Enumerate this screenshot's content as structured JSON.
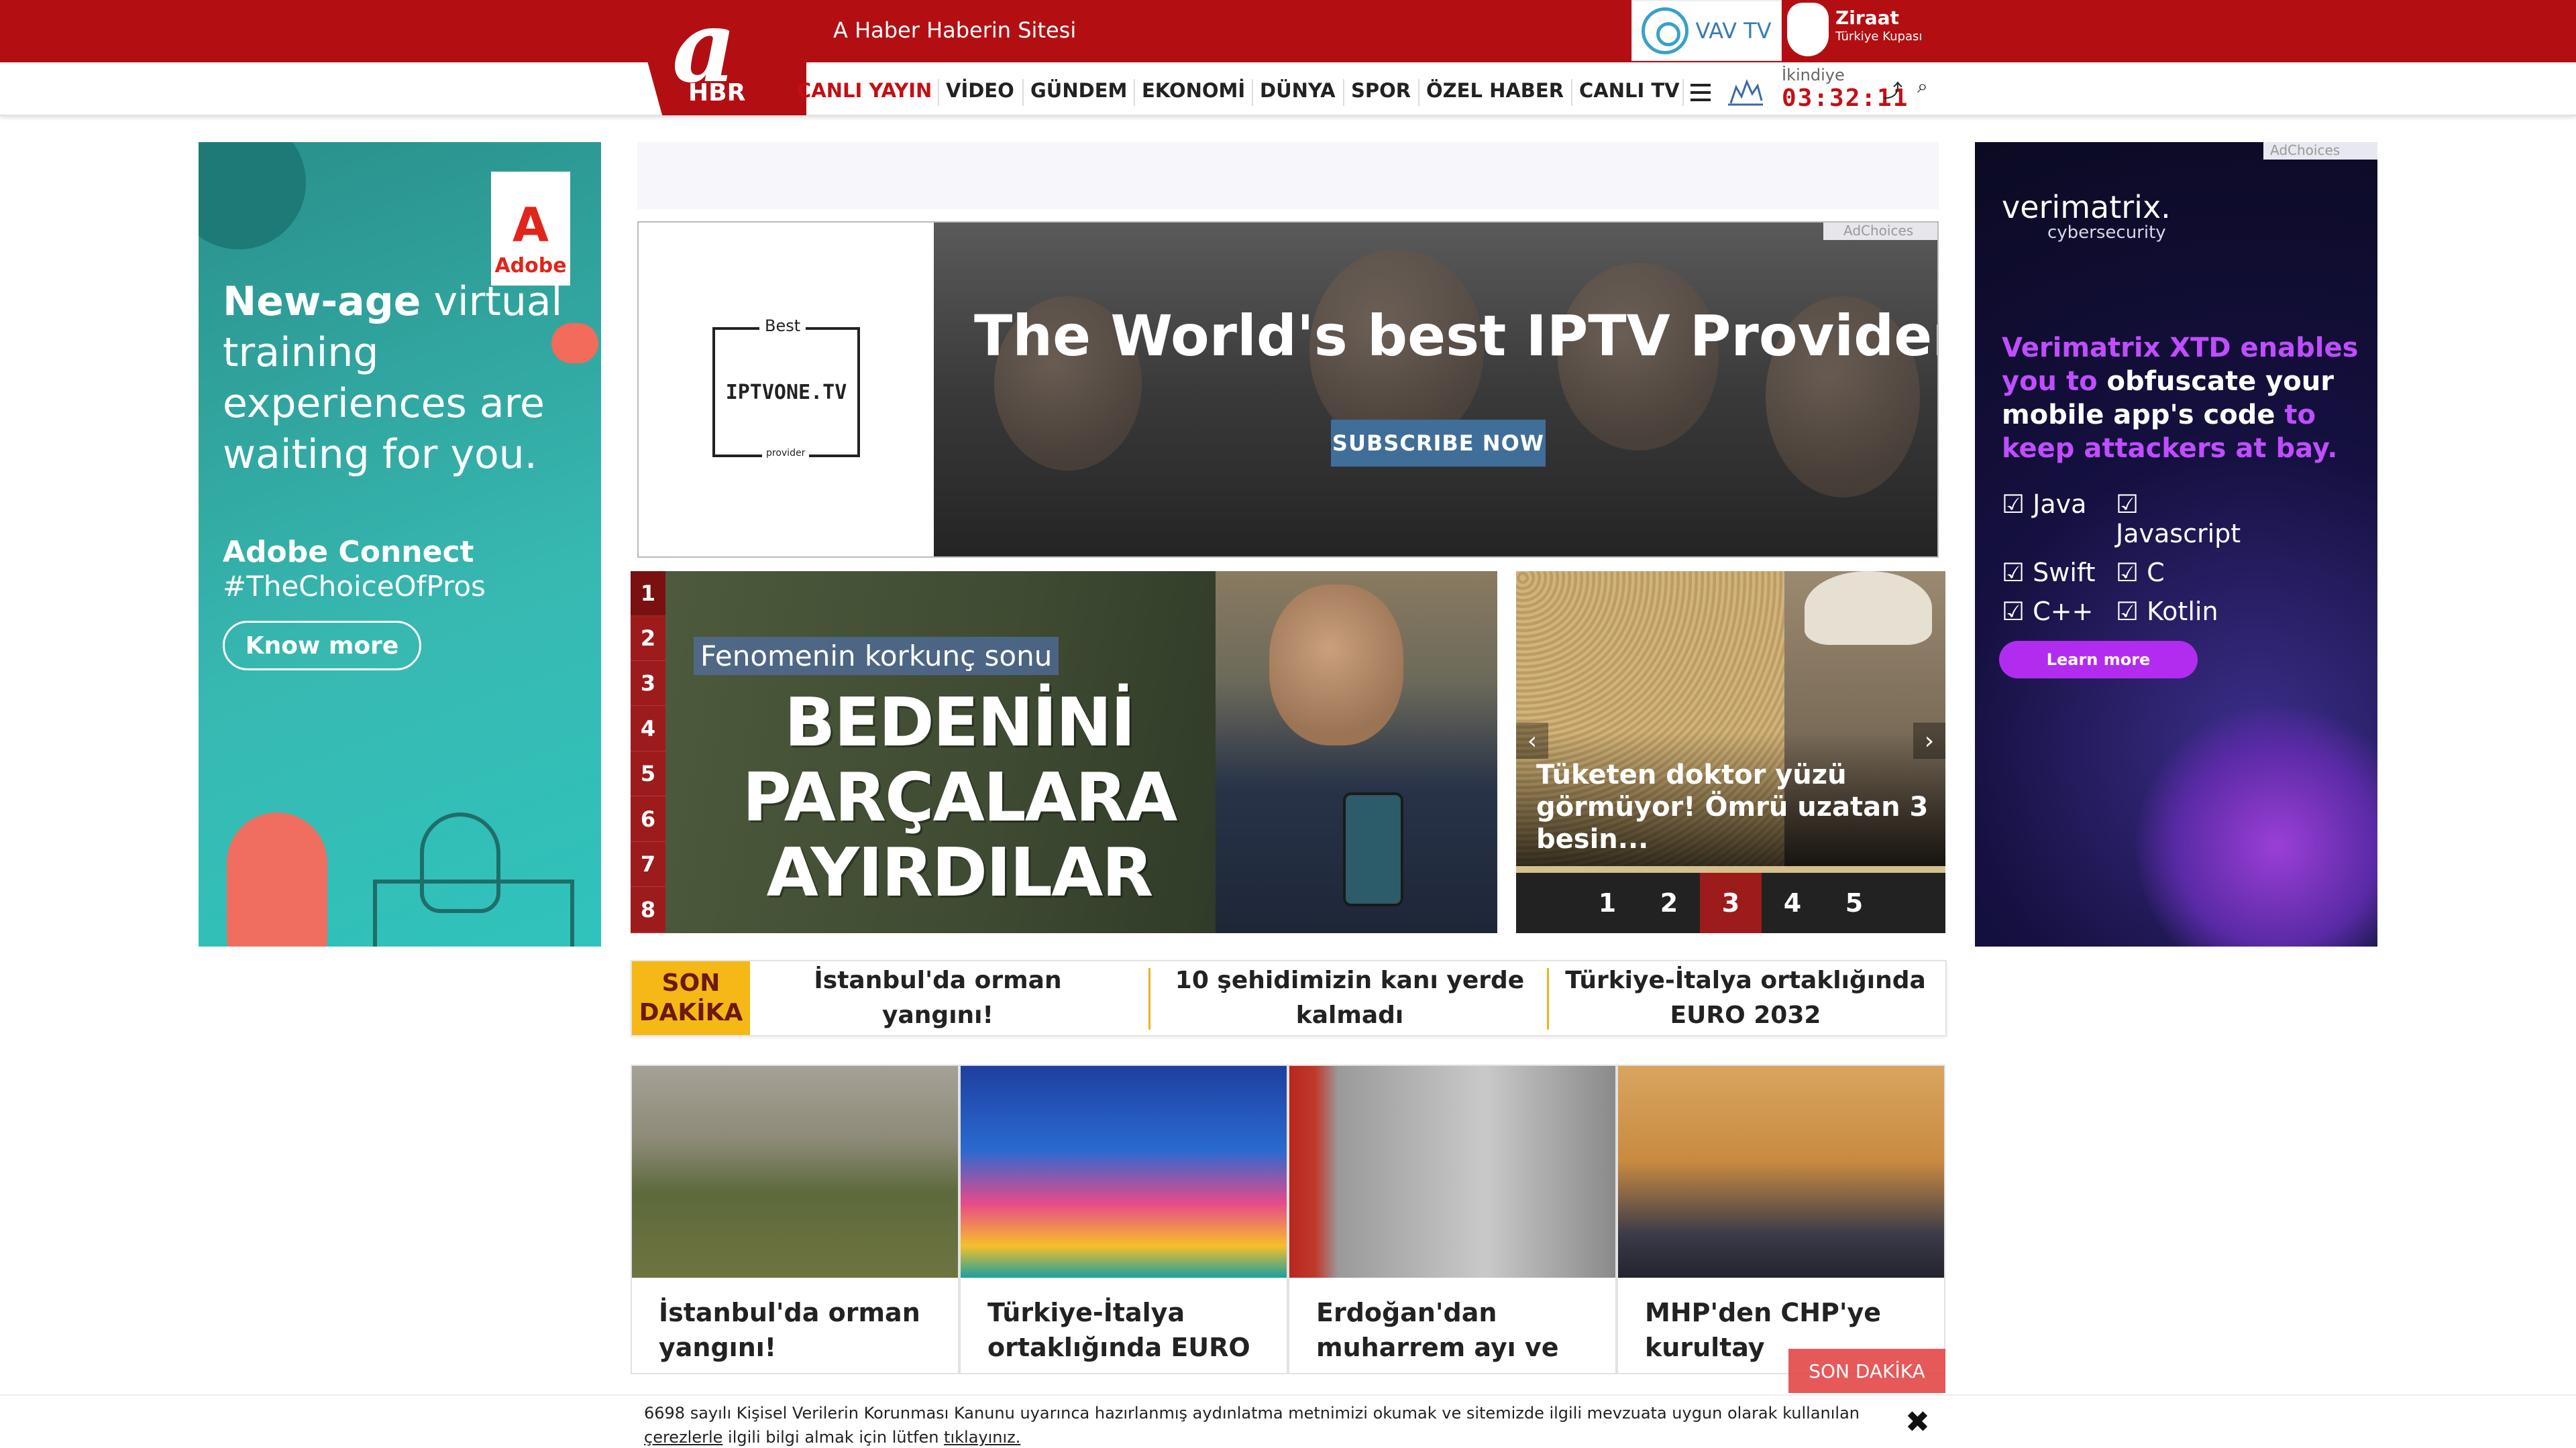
{
  "header": {
    "logo_letter": "a",
    "logo_sub": "HBR",
    "tagline": "A Haber Haberin Sitesi",
    "vavtv_label": "VAV TV",
    "ziraat_name": "Ziraat",
    "ziraat_sub": "Türkiye Kupası",
    "brand_color": "#b30f12"
  },
  "nav": {
    "items": [
      "CANLI YAYIN",
      "VİDEO",
      "GÜNDEM",
      "EKONOMİ",
      "DÜNYA",
      "SPOR",
      "ÖZEL HABER",
      "CANLI TV"
    ],
    "active_color": "#c40f14",
    "prayer_label": "İkindiye",
    "prayer_time": "03:32:11"
  },
  "ads": {
    "left": {
      "brand": "Adobe",
      "headline_bold": "New-age",
      "headline_rest": "virtual training experiences are waiting for you.",
      "product": "Adobe Connect",
      "hashtag": "#TheChoiceOfPros",
      "cta": "Know more"
    },
    "right": {
      "adchoices": "AdChoices",
      "brand": "verimatrix.",
      "brand_sub": "cybersecurity",
      "headline_a": "Verimatrix XTD enables you to ",
      "headline_b": "obfuscate your mobile app's code",
      "headline_c": " to keep attackers at bay.",
      "langs": [
        "Java",
        "Javascript",
        "Swift",
        "C",
        "C++",
        "Kotlin"
      ],
      "cta": "Learn more"
    },
    "banner": {
      "logo_best": "Best",
      "logo_name": "IPTVONE.TV",
      "logo_provider": "provider",
      "headline": "The World's best IPTV Provider",
      "cta": "SUBSCRIBE NOW",
      "adchoices": "AdChoices"
    }
  },
  "slider": {
    "numbers": [
      "1",
      "2",
      "3",
      "4",
      "5",
      "6",
      "7",
      "8"
    ],
    "active_index": 1,
    "kicker": "Fenomenin korkunç sonu",
    "headline_lines": [
      "BEDENİNİ",
      "PARÇALARA",
      "AYIRDILAR"
    ]
  },
  "side_slider": {
    "title": "Tüketen doktor yüzü görmüyor! Ömrü uzatan 3 besin...",
    "prev": "‹",
    "next": "›",
    "pages": [
      "1",
      "2",
      "3",
      "4",
      "5"
    ],
    "active_page": 3
  },
  "breaking": {
    "badge_line1": "SON",
    "badge_line2": "DAKİKA",
    "items": [
      "İstanbul'da orman yangını!",
      "10 şehidimizin kanı yerde kalmadı",
      "Türkiye-İtalya ortaklığında EURO 2032"
    ]
  },
  "cards": [
    {
      "title": "İstanbul'da orman yangını!"
    },
    {
      "title": "Türkiye-İtalya ortaklığında EURO"
    },
    {
      "title": "Erdoğan'dan muharrem ayı ve"
    },
    {
      "title": "MHP'den CHP'ye kurultay"
    }
  ],
  "son_dakika_tag": "SON DAKİKA",
  "cookie": {
    "text_main": "6698 sayılı Kişisel Verilerin Korunması Kanunu uyarınca hazırlanmış aydınlatma metnimizi okumak ve sitemizde ilgili mevzuata uygun olarak kullanılan",
    "link_cookies": "çerezlerle",
    "text_mid": " ilgili bilgi almak için lütfen ",
    "link_click": "tıklayınız.",
    "close": "✖"
  }
}
